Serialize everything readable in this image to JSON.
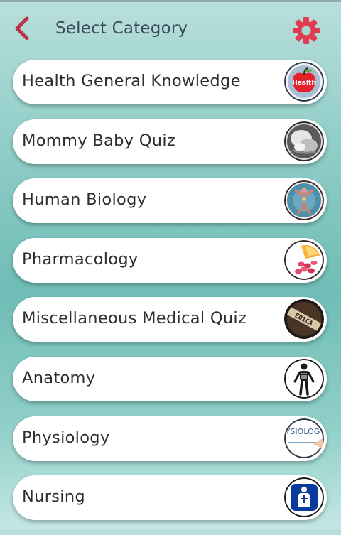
{
  "header": {
    "title": "Select Category"
  },
  "categories": [
    {
      "label": "Health General Knowledge",
      "icon": "apple-health-icon",
      "icon_text": "Health"
    },
    {
      "label": "Mommy Baby Quiz",
      "icon": "mother-baby-icon"
    },
    {
      "label": "Human Biology",
      "icon": "anatomy-figure-icon"
    },
    {
      "label": "Pharmacology",
      "icon": "pills-icon"
    },
    {
      "label": "Miscellaneous Medical Quiz",
      "icon": "medical-tiles-icon",
      "icon_text": "EDICA"
    },
    {
      "label": "Anatomy",
      "icon": "skeleton-icon"
    },
    {
      "label": "Physiology",
      "icon": "physiology-word-icon",
      "icon_text": "YSIOLOG"
    },
    {
      "label": "Nursing",
      "icon": "nurse-sign-icon"
    }
  ],
  "colors": {
    "accent": "#e23a4e",
    "back_arrow": "#b8324a",
    "title": "#3b4a58"
  }
}
